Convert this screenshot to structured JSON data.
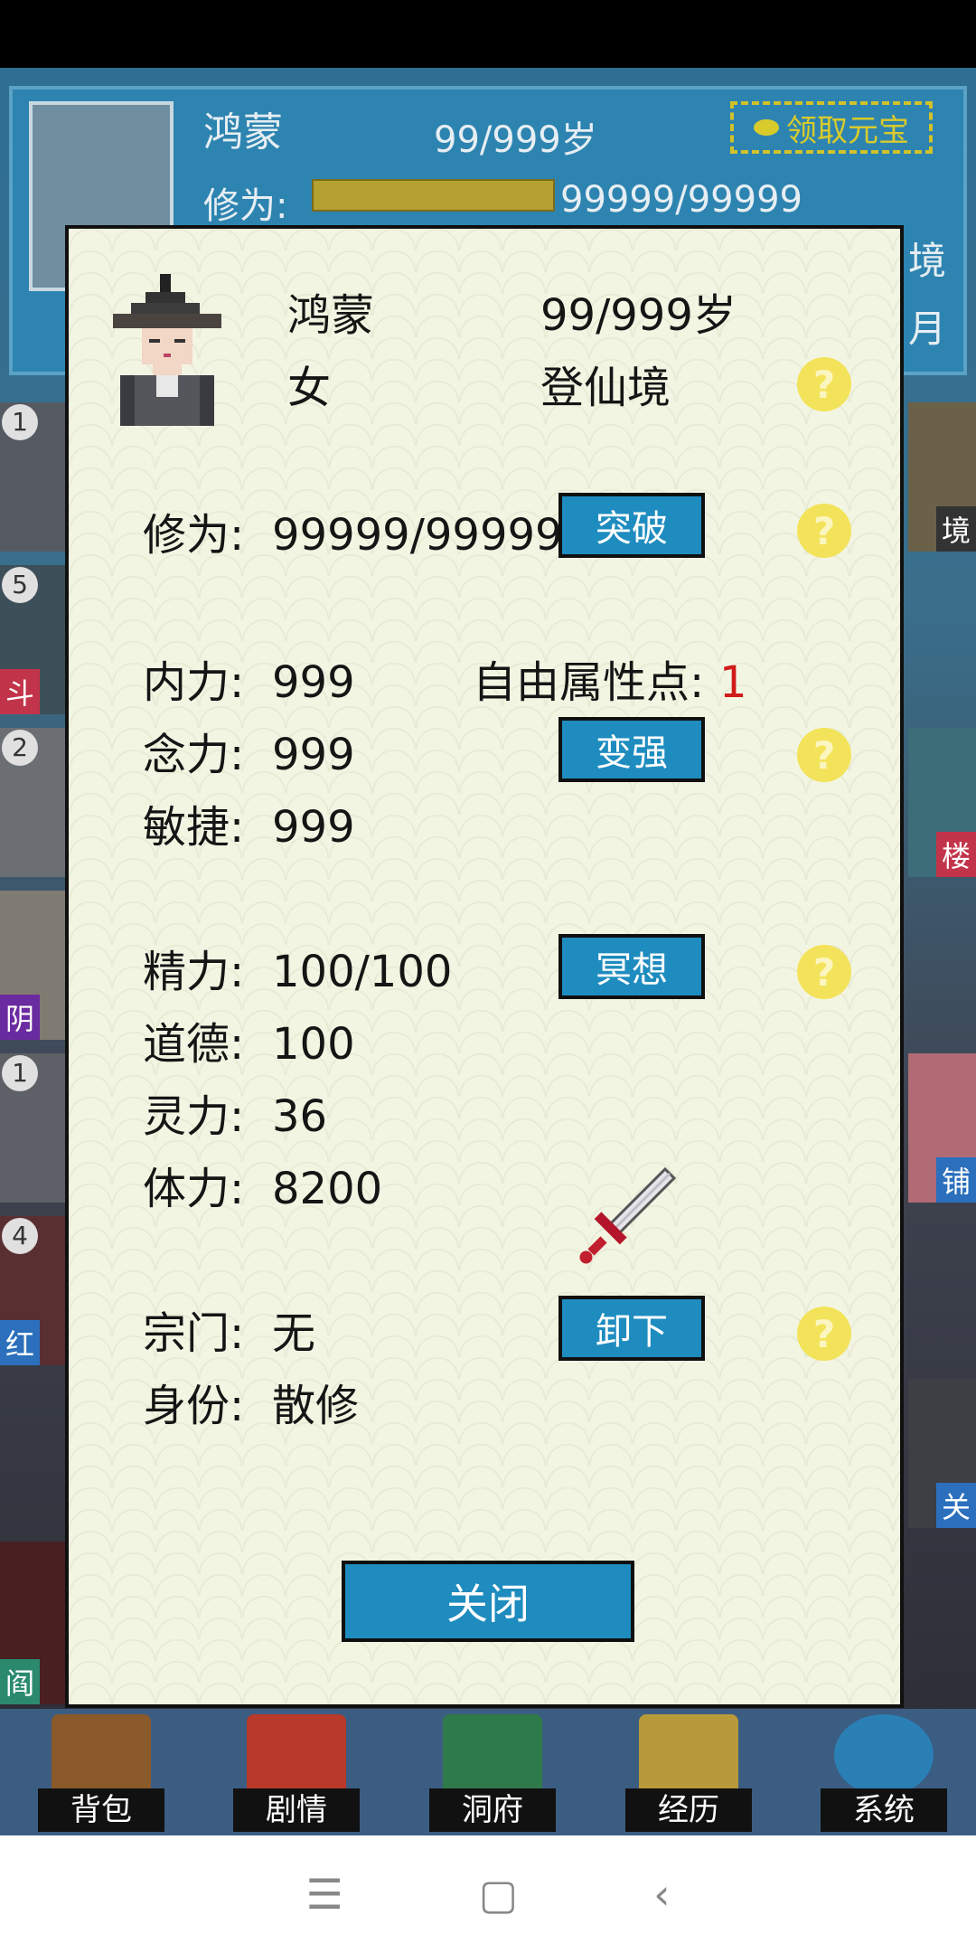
{
  "background": {
    "header": {
      "name": "鸿蒙",
      "age": "99/999岁",
      "claim_label": "领取元宝",
      "cultivation_label": "修为:",
      "cultivation_value": "99999/99999",
      "side_texts": [
        "境",
        "月"
      ]
    },
    "left_side": [
      {
        "num": "1",
        "tag": ""
      },
      {
        "num": "5",
        "tag": "斗"
      },
      {
        "num": "2",
        "tag": ""
      },
      {
        "num": "",
        "tag": "阴"
      },
      {
        "num": "1",
        "tag": ""
      },
      {
        "num": "4",
        "tag": "红"
      },
      {
        "num": "",
        "tag": "阎"
      }
    ],
    "right_side": [
      {
        "tag": "境"
      },
      {
        "tag": "楼"
      },
      {
        "tag": "铺"
      },
      {
        "tag": "关"
      }
    ]
  },
  "modal": {
    "name": "鸿蒙",
    "age": "99/999岁",
    "gender": "女",
    "realm": "登仙境",
    "cultivation_label": "修为:",
    "cultivation_value": "99999/99999",
    "breakthrough_label": "突破",
    "stats_a": [
      {
        "label": "内力:",
        "value": "999"
      },
      {
        "label": "念力:",
        "value": "999"
      },
      {
        "label": "敏捷:",
        "value": "999"
      }
    ],
    "free_points_label": "自由属性点:",
    "free_points_value": "1",
    "strengthen_label": "变强",
    "stats_b": [
      {
        "label": "精力:",
        "value": "100/100"
      },
      {
        "label": "道德:",
        "value": "100"
      },
      {
        "label": "灵力:",
        "value": "36"
      },
      {
        "label": "体力:",
        "value": "8200"
      }
    ],
    "meditate_label": "冥想",
    "sect_label": "宗门:",
    "sect_value": "无",
    "identity_label": "身份:",
    "identity_value": "散修",
    "unequip_label": "卸下",
    "help_symbol": "?",
    "close_label": "关闭"
  },
  "bottom_nav": [
    {
      "label": "背包",
      "icon": "backpack-icon"
    },
    {
      "label": "剧情",
      "icon": "scroll-icon"
    },
    {
      "label": "洞府",
      "icon": "pavilion-icon"
    },
    {
      "label": "经历",
      "icon": "book-icon"
    },
    {
      "label": "系统",
      "icon": "gear-icon"
    }
  ],
  "system_nav": {
    "menu": "☰",
    "home": "▢",
    "back": "‹"
  }
}
